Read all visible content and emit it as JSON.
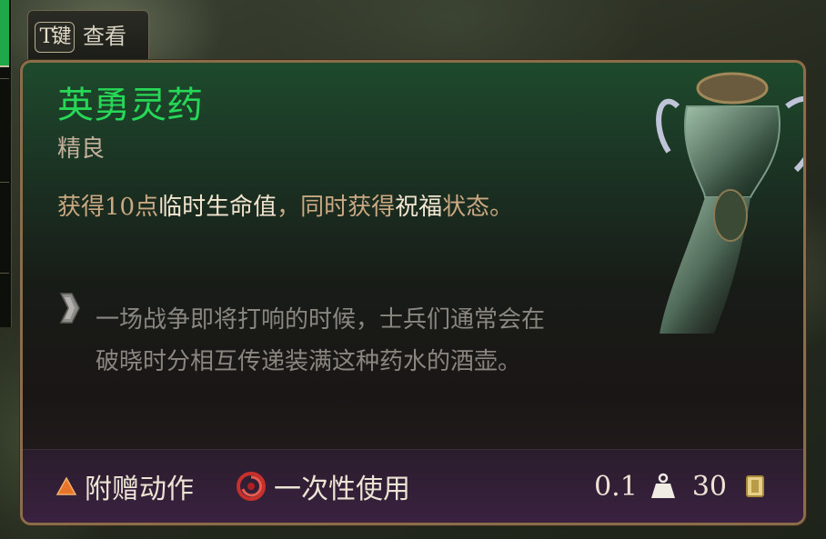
{
  "tab": {
    "key": "T键",
    "label": "查看"
  },
  "item": {
    "name": "英勇灵药",
    "rarity": "精良",
    "description": [
      {
        "text": "获得10点",
        "highlight": false
      },
      {
        "text": "临时生命值",
        "highlight": true
      },
      {
        "text": "，同时获得",
        "highlight": false
      },
      {
        "text": "祝福",
        "highlight": true
      },
      {
        "text": "状态。",
        "highlight": false
      }
    ],
    "flavor_text": "一场战争即将打响的时候，士兵们通常会在破晓时分相互传递装满这种药水的酒壶。",
    "action_type": "附赠动作",
    "usage": "一次性使用",
    "weight": "0.1",
    "value": "30"
  },
  "icons": {
    "action": "orange-triangle-icon",
    "usage": "red-swirl-icon",
    "weight": "weight-icon",
    "value": "gold-coin-icon",
    "flavor": "quote-icon"
  },
  "colors": {
    "name": "#26d856",
    "rarity": "#c4b09a",
    "description": "#c9a882",
    "highlight": "#f2e6d0",
    "flavor": "#8a8680",
    "border": "#8b6d4a"
  }
}
